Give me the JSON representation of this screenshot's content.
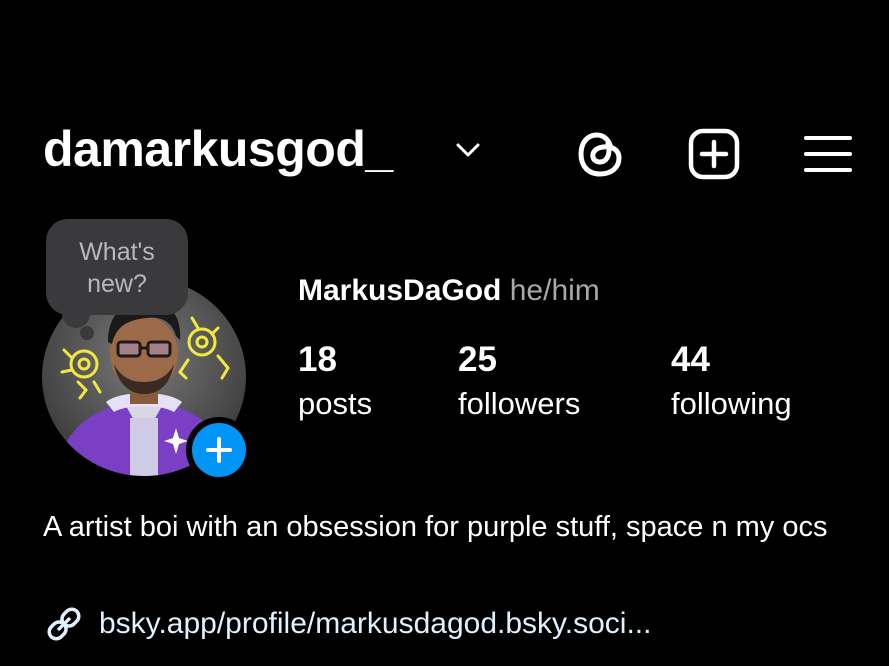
{
  "header": {
    "username": "damarkusgod_",
    "icons": [
      "chevron-down-icon",
      "threads-icon",
      "plus-square-icon",
      "hamburger-menu-icon"
    ]
  },
  "note_bubble": {
    "text": "What's\nnew?"
  },
  "profile": {
    "display_name": "MarkusDaGod",
    "pronouns": "he/him"
  },
  "stats": {
    "posts": {
      "count": "18",
      "label": "posts"
    },
    "followers": {
      "count": "25",
      "label": "followers"
    },
    "following": {
      "count": "44",
      "label": "following"
    }
  },
  "bio": {
    "text": "A artist boi with an obsession for purple stuff, space n my ocs"
  },
  "link": {
    "text": "bsky.app/profile/markusdagod.bsky.soci..."
  },
  "colors": {
    "background": "#000000",
    "text": "#ffffff",
    "muted": "#a8a8a8",
    "accent_blue": "#0095f6",
    "bubble": "#3a3a3c",
    "link": "#e0f1ff"
  }
}
